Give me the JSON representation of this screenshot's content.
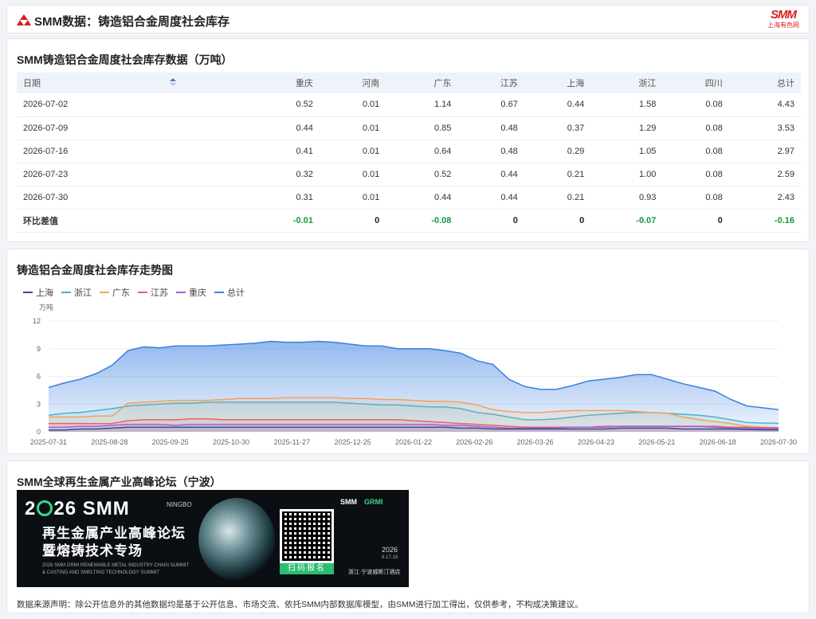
{
  "header": {
    "title": "SMM数据：铸造铝合金周度社会库存",
    "brand_name": "SMM",
    "brand_sub": "上海有色网",
    "accent": "#d8201f"
  },
  "table": {
    "title": "SMM铸造铝合金周度社会库存数据（万吨）",
    "columns": [
      "日期",
      "重庆",
      "河南",
      "广东",
      "江苏",
      "上海",
      "浙江",
      "四川",
      "总计"
    ],
    "rows": [
      [
        "2026-07-02",
        "0.52",
        "0.01",
        "1.14",
        "0.67",
        "0.44",
        "1.58",
        "0.08",
        "4.43"
      ],
      [
        "2026-07-09",
        "0.44",
        "0.01",
        "0.85",
        "0.48",
        "0.37",
        "1.29",
        "0.08",
        "3.53"
      ],
      [
        "2026-07-16",
        "0.41",
        "0.01",
        "0.64",
        "0.48",
        "0.29",
        "1.05",
        "0.08",
        "2.97"
      ],
      [
        "2026-07-23",
        "0.32",
        "0.01",
        "0.52",
        "0.44",
        "0.21",
        "1.00",
        "0.08",
        "2.59"
      ],
      [
        "2026-07-30",
        "0.31",
        "0.01",
        "0.44",
        "0.44",
        "0.21",
        "0.93",
        "0.08",
        "2.43"
      ]
    ],
    "diff_row": [
      "环比差值",
      "-0.01",
      "0",
      "-0.08",
      "0",
      "0",
      "-0.07",
      "0",
      "-0.16"
    ],
    "neg_color": "#18963c"
  },
  "chart": {
    "title": "铸造铝合金周度社会库存走势图",
    "legend": [
      {
        "name": "上海",
        "color": "#3a4f8f"
      },
      {
        "name": "浙江",
        "color": "#48b4c8"
      },
      {
        "name": "广东",
        "color": "#f0a45a"
      },
      {
        "name": "江苏",
        "color": "#ef5f5f"
      },
      {
        "name": "重庆",
        "color": "#a45ee0"
      },
      {
        "name": "总计",
        "color": "#3a7fe0"
      }
    ]
  },
  "chart_data": {
    "type": "area",
    "ylabel": "万吨",
    "ylim": [
      0,
      12
    ],
    "yticks": [
      0,
      3,
      6,
      9,
      12
    ],
    "xticks": [
      "2025-07-31",
      "2025-08-28",
      "2025-09-25",
      "2025-10-30",
      "2025-11-27",
      "2025-12-25",
      "2026-01-22",
      "2026-02-26",
      "2026-03-26",
      "2026-04-23",
      "2026-05-21",
      "2026-06-18",
      "2026-07-30"
    ],
    "grid": true,
    "legend_position": "top-left",
    "series": [
      {
        "name": "总计",
        "values": [
          4.8,
          5.3,
          5.7,
          6.3,
          7.2,
          8.8,
          9.2,
          9.1,
          9.3,
          9.3,
          9.3,
          9.4,
          9.5,
          9.6,
          9.8,
          9.7,
          9.7,
          9.8,
          9.7,
          9.5,
          9.3,
          9.3,
          9.0,
          9.0,
          9.0,
          8.8,
          8.5,
          7.7,
          7.3,
          5.7,
          4.9,
          4.6,
          4.6,
          5.0,
          5.5,
          5.7,
          5.9,
          6.2,
          6.2,
          5.7,
          5.2,
          4.8,
          4.4,
          3.5,
          2.8,
          2.6,
          2.4
        ]
      },
      {
        "name": "浙江",
        "values": [
          1.8,
          2.0,
          2.1,
          2.3,
          2.5,
          2.8,
          2.9,
          3.0,
          3.1,
          3.1,
          3.2,
          3.2,
          3.2,
          3.2,
          3.2,
          3.2,
          3.2,
          3.2,
          3.2,
          3.1,
          3.0,
          2.9,
          2.9,
          2.8,
          2.7,
          2.7,
          2.5,
          2.1,
          1.9,
          1.6,
          1.3,
          1.3,
          1.4,
          1.6,
          1.8,
          1.9,
          2.0,
          2.1,
          2.1,
          2.0,
          1.9,
          1.8,
          1.6,
          1.3,
          1.0,
          0.95,
          0.93
        ]
      },
      {
        "name": "广东",
        "values": [
          1.6,
          1.6,
          1.6,
          1.7,
          1.7,
          3.1,
          3.2,
          3.3,
          3.4,
          3.4,
          3.4,
          3.5,
          3.6,
          3.6,
          3.6,
          3.7,
          3.7,
          3.7,
          3.7,
          3.6,
          3.6,
          3.5,
          3.5,
          3.4,
          3.3,
          3.3,
          3.2,
          2.9,
          2.4,
          2.2,
          2.1,
          2.1,
          2.2,
          2.3,
          2.3,
          2.3,
          2.3,
          2.2,
          2.1,
          2.0,
          1.6,
          1.3,
          1.1,
          0.9,
          0.6,
          0.5,
          0.44
        ]
      },
      {
        "name": "江苏",
        "values": [
          0.9,
          0.9,
          0.9,
          0.9,
          0.9,
          1.2,
          1.3,
          1.3,
          1.3,
          1.4,
          1.4,
          1.3,
          1.3,
          1.3,
          1.3,
          1.3,
          1.3,
          1.3,
          1.3,
          1.3,
          1.3,
          1.3,
          1.3,
          1.2,
          1.1,
          1.0,
          0.9,
          0.8,
          0.7,
          0.6,
          0.5,
          0.5,
          0.5,
          0.5,
          0.5,
          0.6,
          0.6,
          0.6,
          0.6,
          0.6,
          0.6,
          0.6,
          0.6,
          0.5,
          0.5,
          0.45,
          0.44
        ]
      },
      {
        "name": "重庆",
        "values": [
          0.5,
          0.5,
          0.6,
          0.6,
          0.7,
          0.8,
          0.8,
          0.8,
          0.7,
          0.8,
          0.8,
          0.8,
          0.8,
          0.8,
          0.8,
          0.8,
          0.8,
          0.8,
          0.8,
          0.8,
          0.8,
          0.8,
          0.8,
          0.8,
          0.8,
          0.7,
          0.7,
          0.6,
          0.5,
          0.4,
          0.4,
          0.4,
          0.4,
          0.5,
          0.5,
          0.5,
          0.6,
          0.6,
          0.6,
          0.6,
          0.6,
          0.6,
          0.5,
          0.4,
          0.35,
          0.32,
          0.31
        ]
      },
      {
        "name": "上海",
        "values": [
          0.2,
          0.2,
          0.3,
          0.3,
          0.4,
          0.5,
          0.5,
          0.5,
          0.5,
          0.5,
          0.5,
          0.5,
          0.5,
          0.5,
          0.5,
          0.5,
          0.5,
          0.5,
          0.5,
          0.5,
          0.5,
          0.5,
          0.5,
          0.5,
          0.5,
          0.5,
          0.4,
          0.4,
          0.3,
          0.3,
          0.3,
          0.3,
          0.3,
          0.3,
          0.3,
          0.3,
          0.4,
          0.4,
          0.4,
          0.4,
          0.3,
          0.3,
          0.3,
          0.3,
          0.25,
          0.22,
          0.21
        ]
      }
    ]
  },
  "forum": {
    "title": "SMM全球再生金属产业高峰论坛（宁波）",
    "banner_year_a": "2",
    "banner_year_b": "26 SMM",
    "banner_city": "NINGBO",
    "banner_line2": "再生金属产业高峰论坛",
    "banner_line3": "暨熔铸技术专场",
    "banner_en1": "2026 SMM GRMI RENEWABLE METAL INDUSTRY CHAIN SUMMIT",
    "banner_en2": "& CASTING AND SMELTING TECHNOLOGY SUMMIT",
    "scan_label": "扫码报名",
    "banner_smm": "SMM",
    "banner_grmi": "GRMI",
    "banner_year": "2026",
    "banner_dates": "8.17-18",
    "banner_venue": "浙江·宁波威斯汀酒店",
    "disclaimer": "数据来源声明：除公开信息外的其他数据均是基于公开信息、市场交流、依托SMM内部数据库模型，由SMM进行加工得出，仅供参考，不构成决策建议。"
  }
}
